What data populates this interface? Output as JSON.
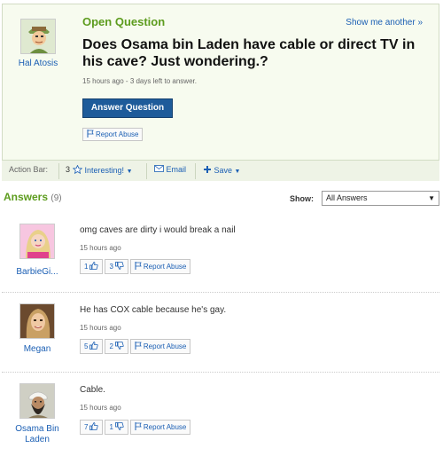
{
  "question": {
    "label": "Open Question",
    "show_another": "Show me another »",
    "title": "Does Osama bin Laden have cable or direct TV in his cave? Just wondering.?",
    "meta": "15 hours ago - 3 days left to answer.",
    "answer_button": "Answer Question",
    "report_abuse": "Report Abuse",
    "asker": {
      "name": "Hal Atosis",
      "avatar": "avatar-icon"
    }
  },
  "action_bar": {
    "label": "Action Bar:",
    "interesting_count": "3",
    "interesting_label": "Interesting!",
    "email_label": "Email",
    "save_label": "Save"
  },
  "answers_section": {
    "title": "Answers",
    "count": "(9)",
    "show_label": "Show:",
    "show_value": "All Answers"
  },
  "answers": [
    {
      "author": "BarbieGi...",
      "text": "omg caves are dirty i would break a nail",
      "time": "15 hours ago",
      "thumbs_up": "1",
      "thumbs_down": "3",
      "report": "Report Abuse"
    },
    {
      "author": "Megan",
      "text": "He has COX cable because he's gay.",
      "time": "15 hours ago",
      "thumbs_up": "5",
      "thumbs_down": "2",
      "report": "Report Abuse"
    },
    {
      "author": "Osama Bin Laden",
      "text": "Cable.",
      "time": "15 hours ago",
      "thumbs_up": "7",
      "thumbs_down": "1",
      "report": "Report Abuse"
    }
  ],
  "colors": {
    "accent_green": "#5d9c1e",
    "link_blue": "#1b5fb4",
    "button_blue": "#1e5b9a"
  }
}
